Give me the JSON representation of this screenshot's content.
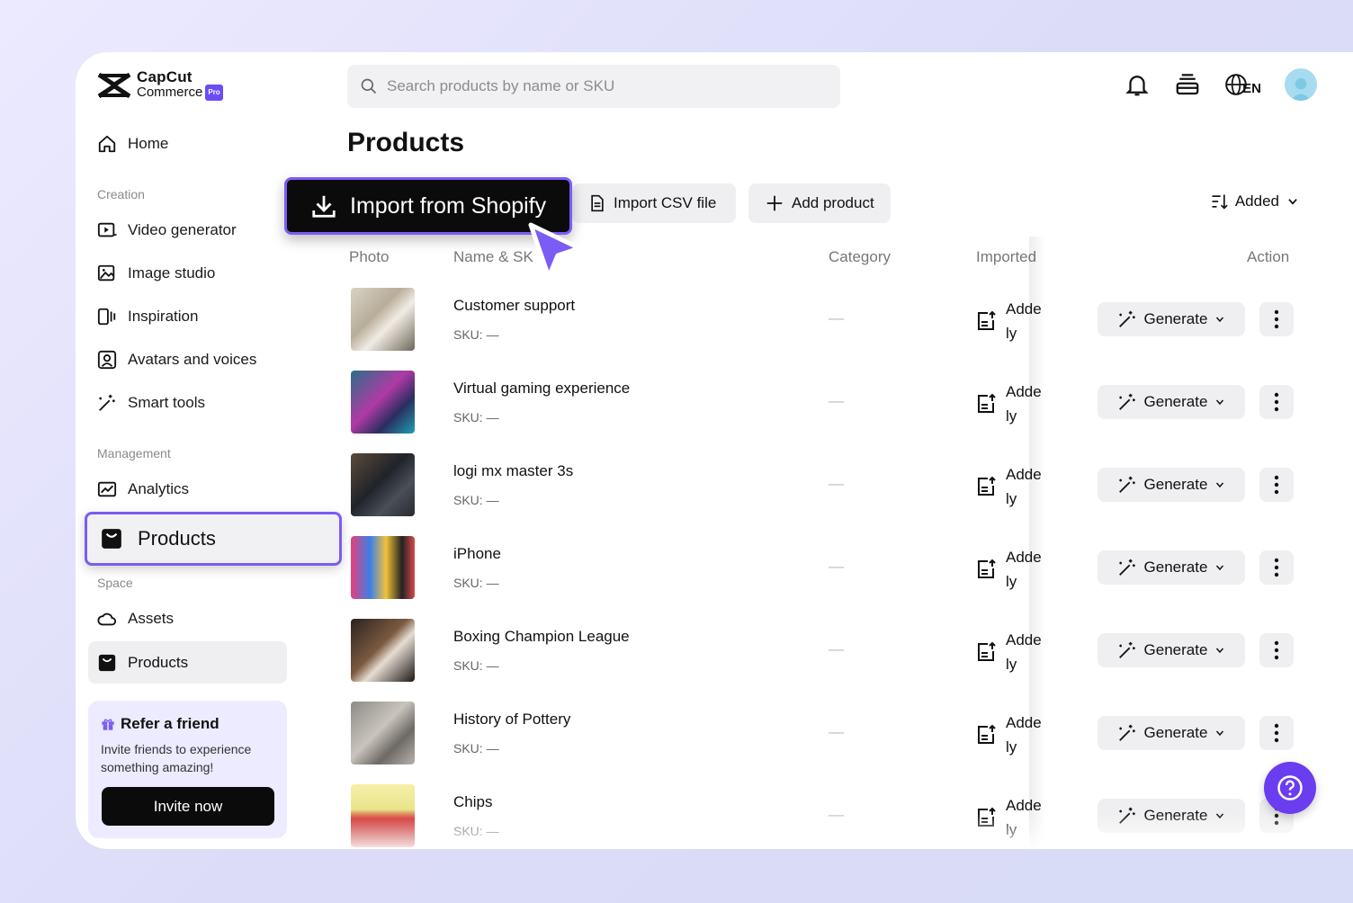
{
  "app": {
    "brand_line1": "CapCut",
    "brand_line2": "Commerce",
    "badge": "Pro"
  },
  "search": {
    "placeholder": "Search products by name or SKU"
  },
  "header": {
    "language": "EN"
  },
  "sidebar": {
    "home": "Home",
    "creation_label": "Creation",
    "creation_items": [
      "Video generator",
      "Image studio",
      "Inspiration",
      "Avatars and voices",
      "Smart tools"
    ],
    "management_label": "Management",
    "analytics": "Analytics",
    "products_highlight": "Products",
    "space_label": "Space",
    "assets": "Assets",
    "products": "Products"
  },
  "refer": {
    "title": "Refer a friend",
    "description": "Invite friends to experience something amazing!",
    "button": "Invite now"
  },
  "page": {
    "title": "Products",
    "import_shopify": "Import from Shopify",
    "import_csv": "Import CSV file",
    "add_product": "Add product",
    "sort_label": "Added"
  },
  "table": {
    "columns": [
      "Photo",
      "Name & SK",
      "Category",
      "Imported",
      "Action"
    ],
    "rows": [
      {
        "name": "Customer support",
        "sku": "SKU: —",
        "category": "—",
        "imported_l1": "Adde",
        "imported_l2": "ly",
        "action": "Generate"
      },
      {
        "name": "Virtual gaming experience",
        "sku": "SKU: —",
        "category": "—",
        "imported_l1": "Adde",
        "imported_l2": "ly",
        "action": "Generate"
      },
      {
        "name": "logi mx master 3s",
        "sku": "SKU: —",
        "category": "—",
        "imported_l1": "Adde",
        "imported_l2": "ly",
        "action": "Generate"
      },
      {
        "name": "iPhone",
        "sku": "SKU: —",
        "category": "—",
        "imported_l1": "Adde",
        "imported_l2": "ly",
        "action": "Generate"
      },
      {
        "name": "Boxing Champion League",
        "sku": "SKU: —",
        "category": "—",
        "imported_l1": "Adde",
        "imported_l2": "ly",
        "action": "Generate"
      },
      {
        "name": "History of Pottery",
        "sku": "SKU: —",
        "category": "—",
        "imported_l1": "Adde",
        "imported_l2": "ly",
        "action": "Generate"
      },
      {
        "name": "Chips",
        "sku": "SKU: —",
        "category": "—",
        "imported_l1": "Adde",
        "imported_l2": "ly",
        "action": "Generate"
      }
    ]
  },
  "colors": {
    "accent": "#7b5cf5",
    "help": "#6a3df0",
    "button_dark": "#0b0b0b",
    "chip_bg": "#efeff1"
  }
}
